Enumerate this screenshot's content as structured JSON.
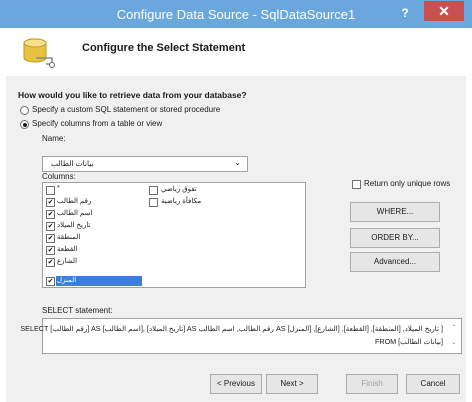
{
  "window": {
    "title": "Configure Data Source - SqlDataSource1",
    "help": "?",
    "close": "✕"
  },
  "header": {
    "title": "Configure the Select Statement",
    "icon": "database-icon"
  },
  "question": "How would you like to retrieve data from your database?",
  "options": [
    {
      "label": "Specify a custom SQL statement or stored procedure",
      "selected": false
    },
    {
      "label": "Specify columns from a table or view",
      "selected": true
    }
  ],
  "name_label": "Name:",
  "name_value": "بيانات الطالب",
  "columns_label": "Columns:",
  "columns_left": [
    {
      "label": "*",
      "checked": false
    },
    {
      "label": "رقم الطالب",
      "checked": true
    },
    {
      "label": "اسم الطالب",
      "checked": true
    },
    {
      "label": "تاريخ الميلاد",
      "checked": true
    },
    {
      "label": "المنطقة",
      "checked": true
    },
    {
      "label": "القطعة",
      "checked": true
    },
    {
      "label": "الشارع",
      "checked": true
    },
    {
      "label": "المنزل",
      "checked": true,
      "selected": true
    }
  ],
  "columns_right": [
    {
      "label": "تفوق رياضي",
      "checked": false
    },
    {
      "label": "مكافأة رياضية",
      "checked": false
    }
  ],
  "unique_rows_label": "Return only unique rows",
  "buttons": {
    "where": "WHERE...",
    "orderby": "ORDER BY...",
    "advanced": "Advanced..."
  },
  "statement_label": "SELECT statement:",
  "statement_line1": "SELECT [رقم الطالب] AS [اسم الطالب], [تاريخ الميلاد] AS رقم الطالب, اسم الطالب AS تاريخ الميلاد, [المنطقة], [القطعة], [الشارع], [المنزل] ]",
  "statement_line2": "FROM [بيانات الطالب]",
  "footer": {
    "previous": "< Previous",
    "next": "Next >",
    "finish": "Finish",
    "cancel": "Cancel"
  }
}
